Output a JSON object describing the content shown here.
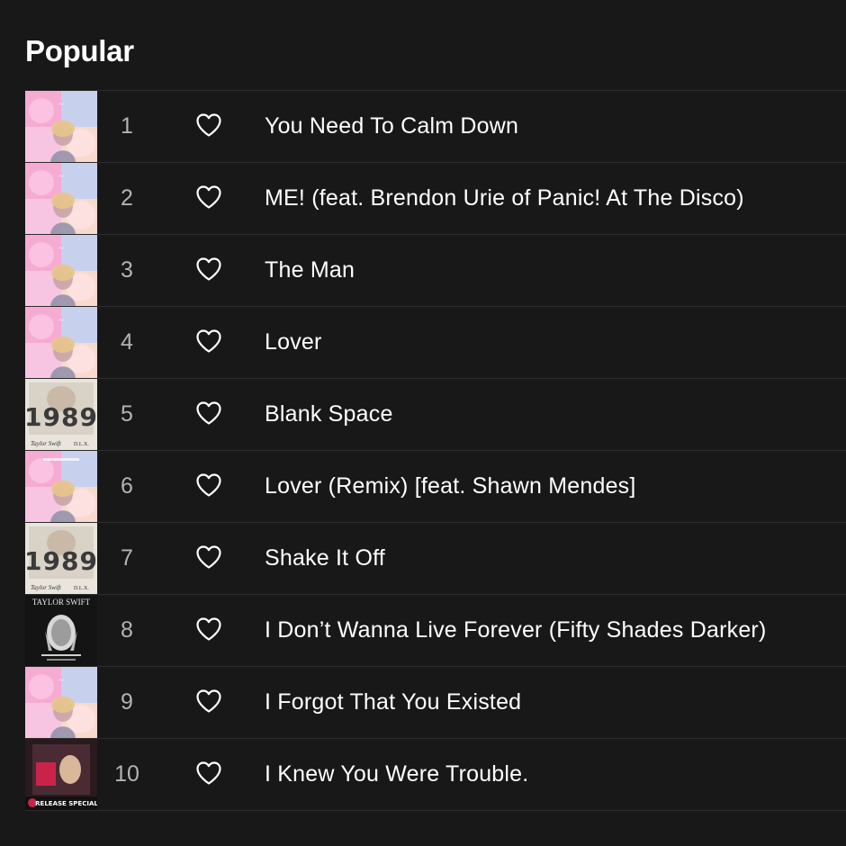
{
  "section": {
    "title": "Popular"
  },
  "tracks": [
    {
      "number": "1",
      "title": "You Need To Calm Down",
      "cover": "lover"
    },
    {
      "number": "2",
      "title": "ME! (feat. Brendon Urie of Panic! At The Disco)",
      "cover": "lover"
    },
    {
      "number": "3",
      "title": "The Man",
      "cover": "lover"
    },
    {
      "number": "4",
      "title": "Lover",
      "cover": "lover"
    },
    {
      "number": "5",
      "title": "Blank Space",
      "cover": "1989"
    },
    {
      "number": "6",
      "title": "Lover (Remix) [feat. Shawn Mendes]",
      "cover": "lover-remix"
    },
    {
      "number": "7",
      "title": "Shake It Off",
      "cover": "1989"
    },
    {
      "number": "8",
      "title": "I Don’t Wanna Live Forever (Fifty Shades Darker)",
      "cover": "fifty-shades"
    },
    {
      "number": "9",
      "title": "I Forgot That You Existed",
      "cover": "lover"
    },
    {
      "number": "10",
      "title": "I Knew You Were Trouble.",
      "cover": "red-radio"
    }
  ],
  "cover_text": {
    "1989": {
      "main": "1989",
      "artist": "Taylor Swift",
      "edition": "D.L.X."
    },
    "fifty-shades": {
      "artist": "TAYLOR SWIFT"
    },
    "red-radio": {
      "footer": "RELEASE SPECIAL"
    }
  },
  "colors": {
    "background": "#181818",
    "divider": "#2c2c2c",
    "text_primary": "#ffffff",
    "text_secondary": "#b3b3b3"
  },
  "icons": {
    "like": "heart-outline-icon"
  }
}
